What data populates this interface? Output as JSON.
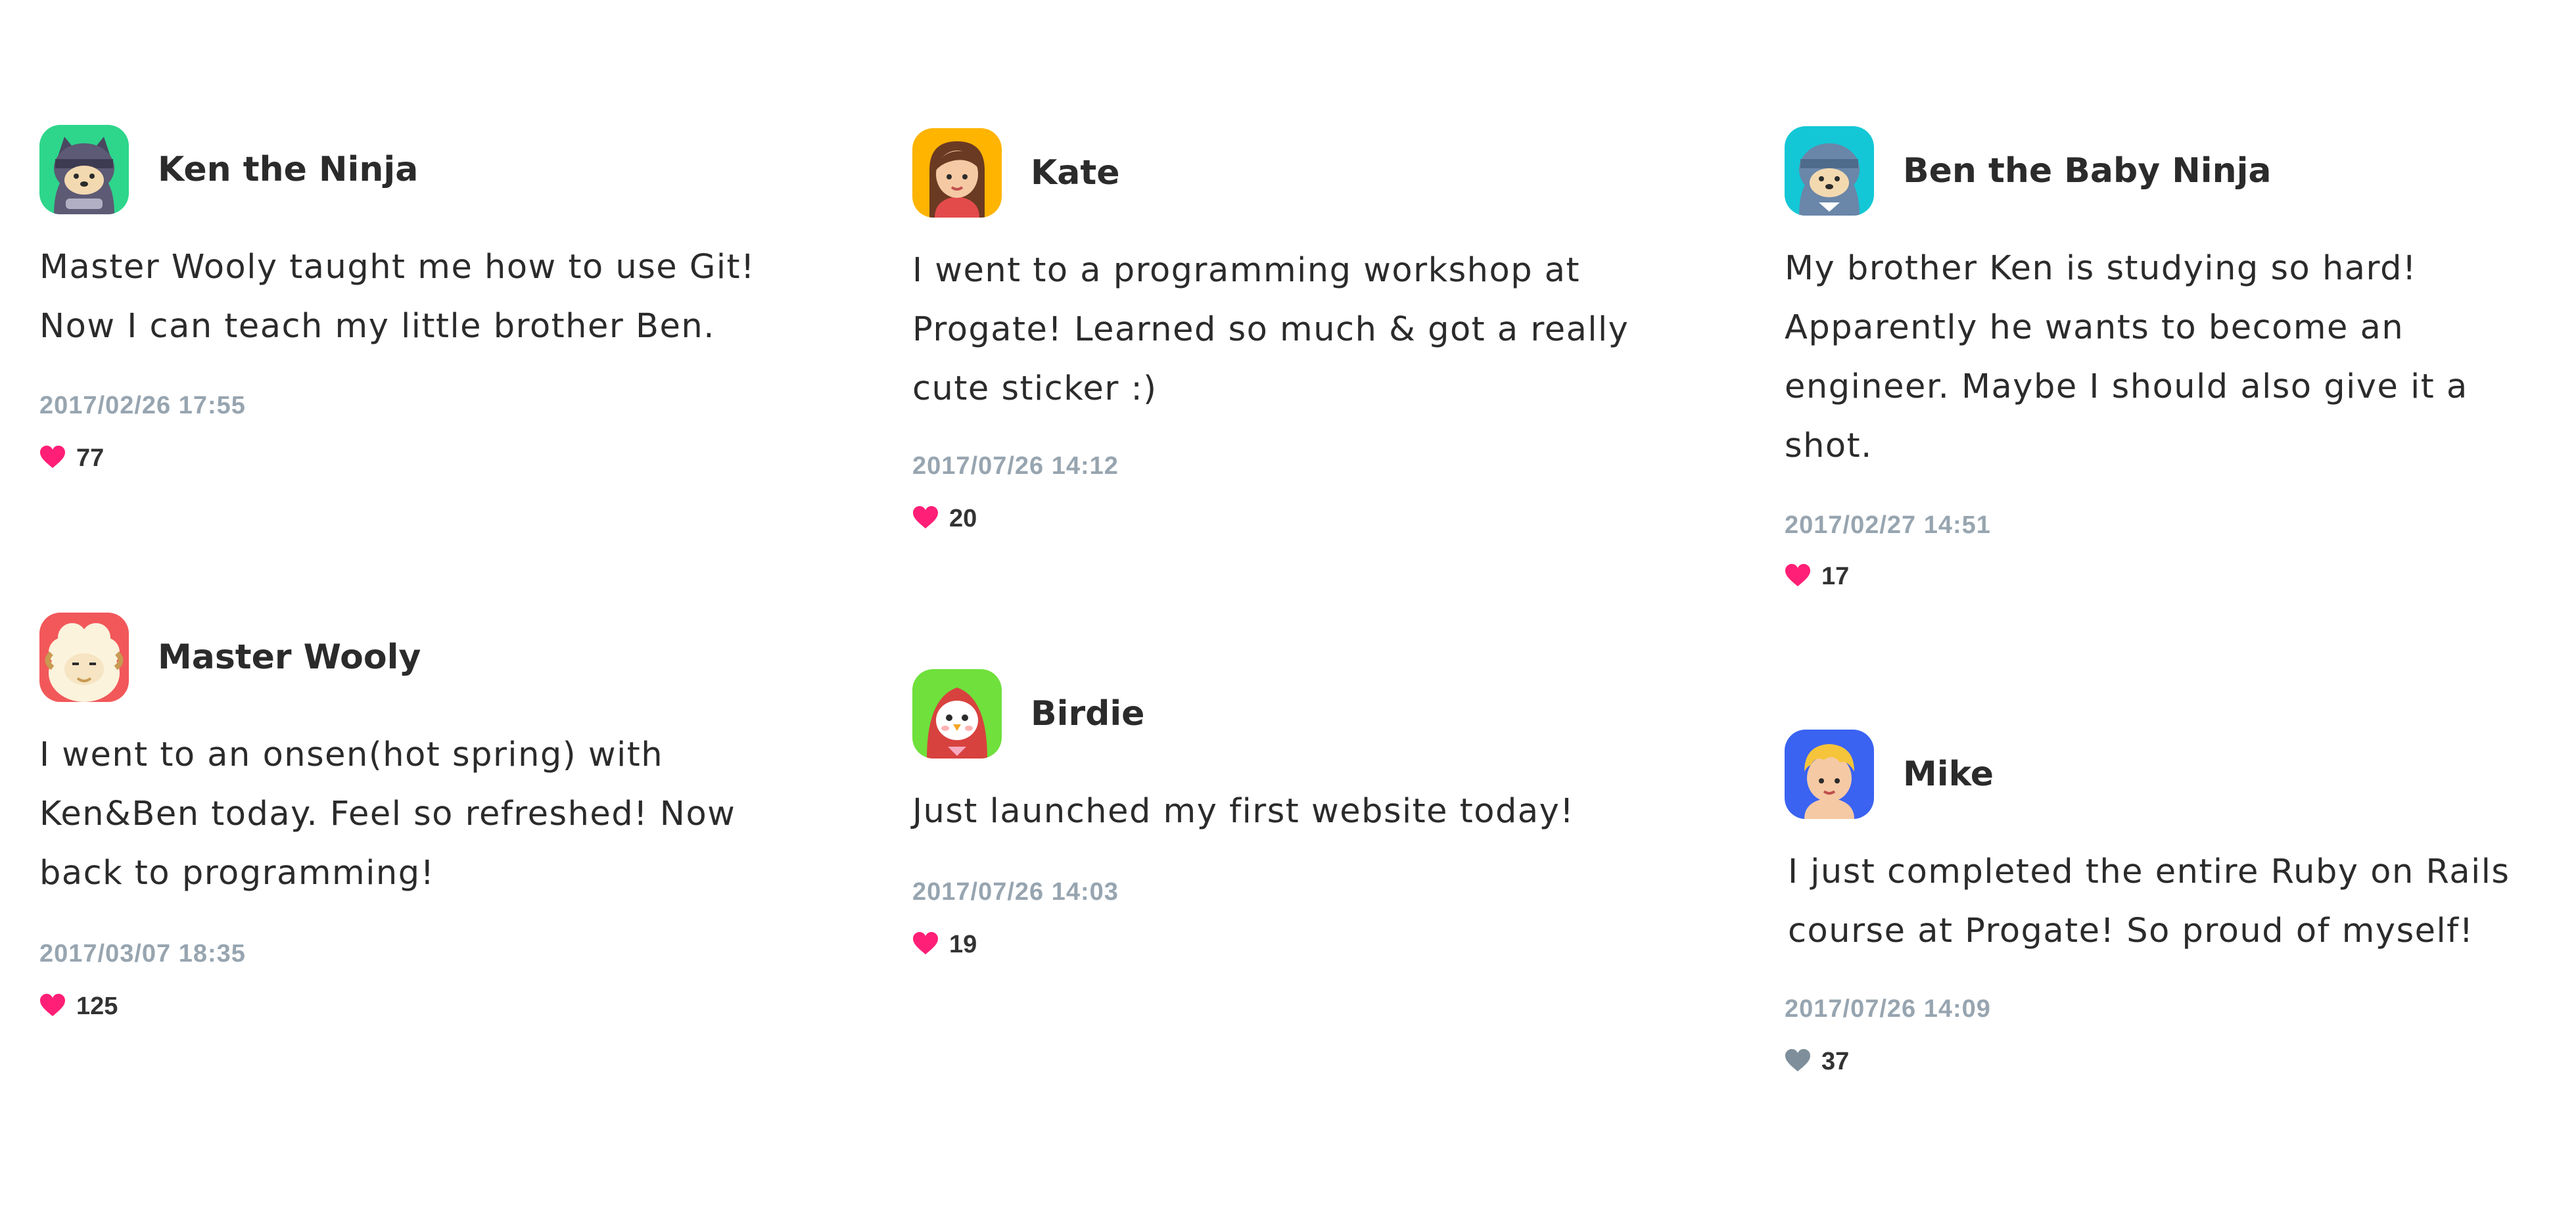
{
  "colors": {
    "liked_heart": "#ff1f76",
    "unliked_heart": "#7e8f9b",
    "date_text": "#97a5b0"
  },
  "posts": [
    {
      "user": "Ken the Ninja",
      "avatar_icon": "ninja-cat-avatar-icon",
      "avatar_bg": "#2dd68b",
      "text": "Master Wooly taught me how to use Git! Now I can teach my little brother Ben.",
      "date": "2017/02/26 17:55",
      "likes": "77",
      "liked": true
    },
    {
      "user": "Kate",
      "avatar_icon": "girl-avatar-icon",
      "avatar_bg": "#ffb400",
      "text": "I went to a programming workshop at Progate! Learned so much & got a really cute sticker :)",
      "date": "2017/07/26 14:12",
      "likes": "20",
      "liked": true
    },
    {
      "user": "Ben the Baby Ninja",
      "avatar_icon": "baby-ninja-avatar-icon",
      "avatar_bg": "#14c7d6",
      "text": "My brother Ken is studying so hard! Apparently he wants to become an engineer. Maybe I should also give it a shot.",
      "date": "2017/02/27 14:51",
      "likes": "17",
      "liked": true
    },
    {
      "user": "Master Wooly",
      "avatar_icon": "sheep-avatar-icon",
      "avatar_bg": "#f2585a",
      "text": "I went to an onsen(hot spring) with Ken&Ben today. Feel so refreshed! Now back to programming!",
      "date": "2017/03/07 18:35",
      "likes": "125",
      "liked": true
    },
    {
      "user": "Birdie",
      "avatar_icon": "bird-avatar-icon",
      "avatar_bg": "#6fe03c",
      "text": "Just launched my first website today!",
      "date": "2017/07/26 14:03",
      "likes": "19",
      "liked": true
    },
    {
      "user": "Mike",
      "avatar_icon": "boy-avatar-icon",
      "avatar_bg": "#3a63f2",
      "text": "I just completed the entire Ruby on Rails course at Progate! So proud of myself!",
      "date": "2017/07/26 14:09",
      "likes": "37",
      "liked": false
    }
  ]
}
